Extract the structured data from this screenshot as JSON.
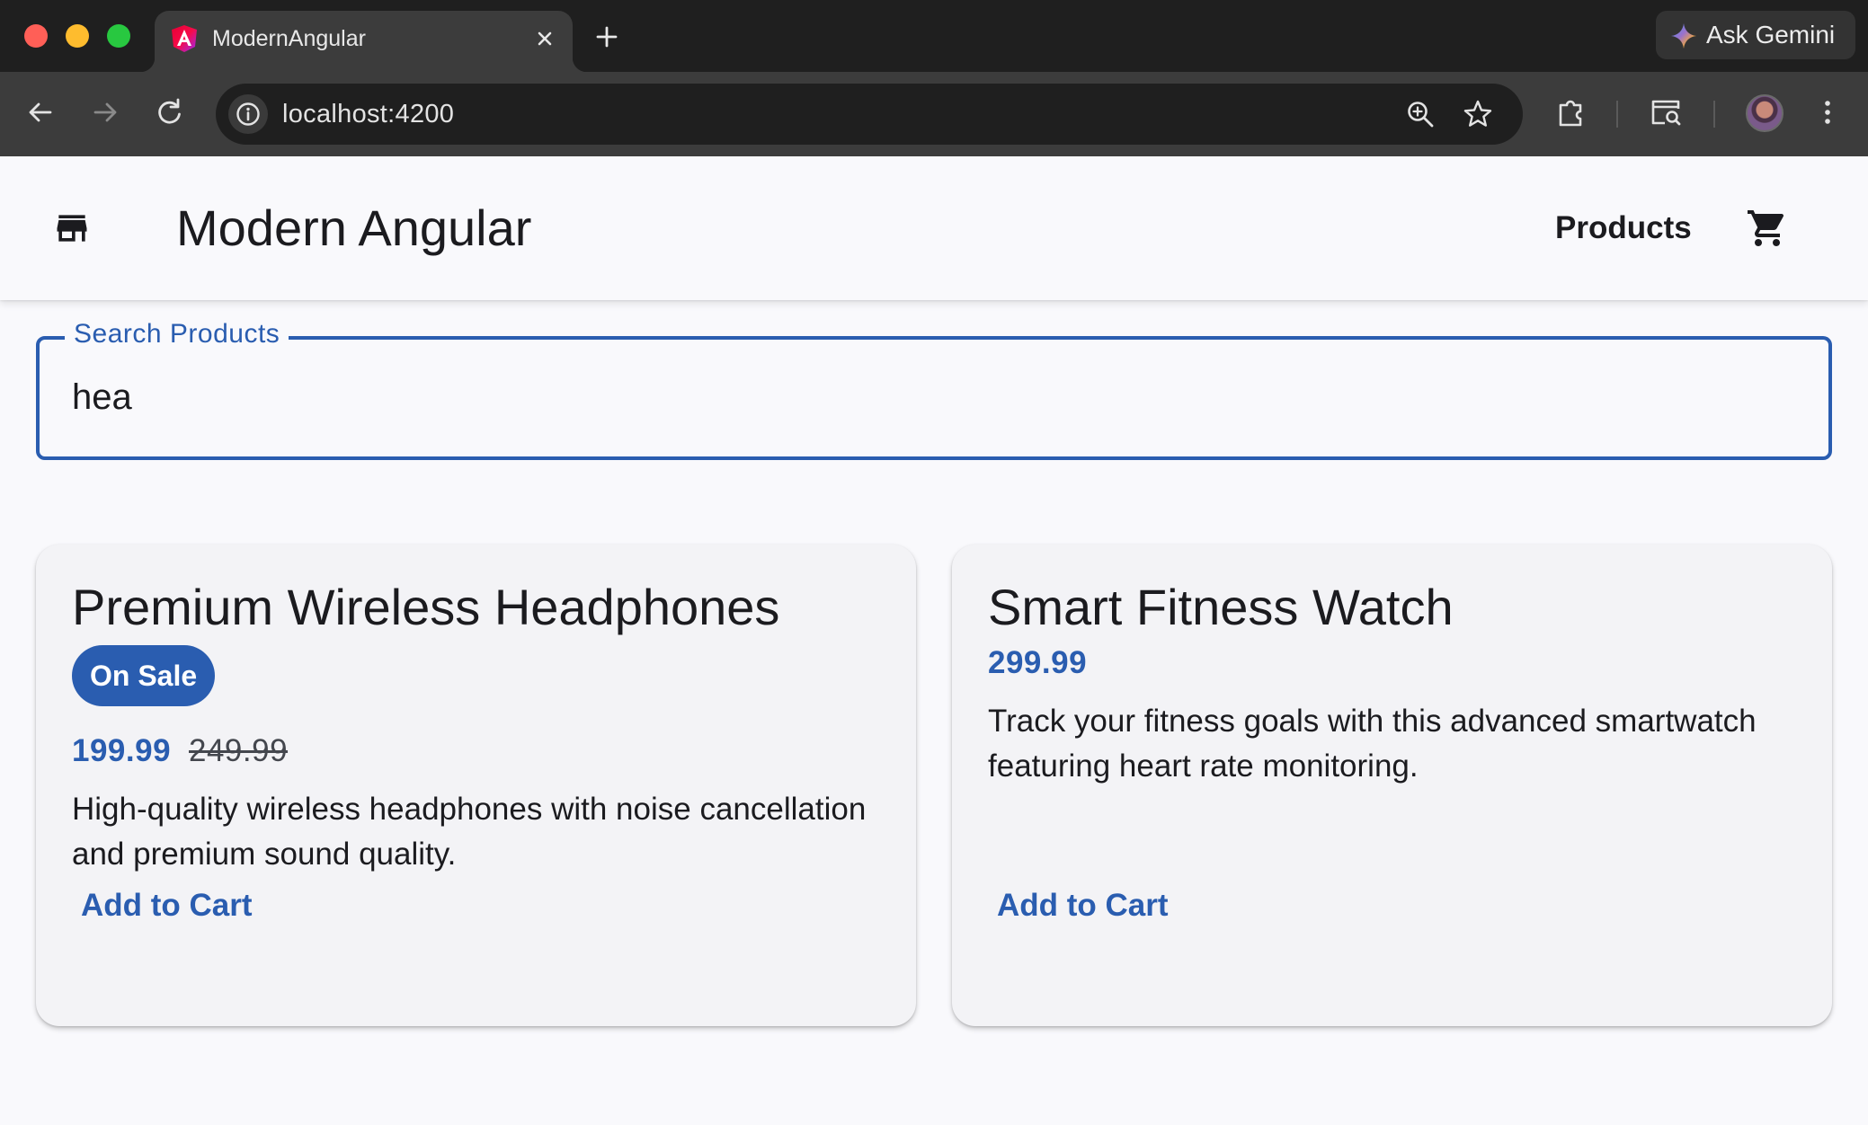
{
  "browser": {
    "tab": {
      "title": "ModernAngular"
    },
    "new_tab_label": "+",
    "gemini_label": "Ask Gemini",
    "address": {
      "url": "localhost:4200"
    },
    "colors": {
      "chrome_dark": "#1f1f1f",
      "chrome_toolbar": "#3c3c3c"
    }
  },
  "app": {
    "title": "Modern Angular",
    "nav": {
      "products": "Products"
    },
    "icons": {
      "logo": "storefront-icon",
      "cart": "shopping-cart-icon"
    },
    "colors": {
      "primary": "#2a5db0",
      "surface": "#f9f9fc",
      "card": "#f3f3f6"
    }
  },
  "search": {
    "label": "Search Products",
    "value": "hea"
  },
  "products": [
    {
      "name": "Premium Wireless Headphones",
      "badge": "On Sale",
      "price": "199.99",
      "old_price": "249.99",
      "description": "High-quality wireless headphones with noise cancellation and premium sound quality.",
      "action": "Add to Cart"
    },
    {
      "name": "Smart Fitness Watch",
      "price": "299.99",
      "description": "Track your fitness goals with this advanced smartwatch featuring heart rate monitoring.",
      "action": "Add to Cart"
    }
  ]
}
